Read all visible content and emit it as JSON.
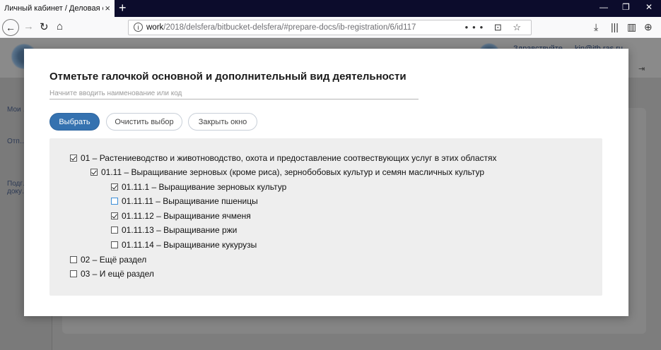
{
  "browser": {
    "tab_title": "Личный кабинет / Деловая сфера",
    "tab_close": "×",
    "new_tab": "+",
    "url_host": "work",
    "url_path": "/2018/delsfera/bitbucket-delsfera/#prepare-docs/ib-registration/6/id117",
    "url_actions": "••• ⊡ ☆",
    "win_minimize": "—",
    "win_restore": "❐",
    "win_close": "✕"
  },
  "background": {
    "header_text": "Здравствуйте,  …kin@itb.ras.ru",
    "sidebar": [
      "Мои …",
      "Отп… доку…",
      "Подг… доку…"
    ]
  },
  "modal": {
    "title": "Отметьте галочкой основной и дополнительный вид деятельности",
    "search_placeholder": "Начните вводить наименование или код",
    "select_button": "Выбрать",
    "clear_button": "Очистить выбор",
    "close_button": "Закрыть окно",
    "tree": [
      {
        "label": "01 – Растениеводство и животноводство, охота и предоставление соотвествующих услуг в этих областях",
        "checked": true
      },
      {
        "label": "01.11 – Выращивание зерновых (кроме риса), зернобобовых культур и семян масличных культур",
        "checked": true
      },
      {
        "label": "01.11.1 – Выращивание зерновых культур",
        "checked": true
      },
      {
        "label": "01.11.11 – Выращивание пшеницы",
        "checked": false
      },
      {
        "label": "01.11.12 – Выращивание ячменя",
        "checked": true
      },
      {
        "label": "01.11.13 – Выращивание ржи",
        "checked": false
      },
      {
        "label": "01.11.14 – Выращивание кукурузы",
        "checked": false
      },
      {
        "label": "02 – Ещё раздел",
        "checked": false
      },
      {
        "label": "03 – И ещё раздел",
        "checked": false
      }
    ]
  },
  "colors": {
    "primary_button": "#3572b0",
    "tab_strip": "#0c0c2c"
  }
}
